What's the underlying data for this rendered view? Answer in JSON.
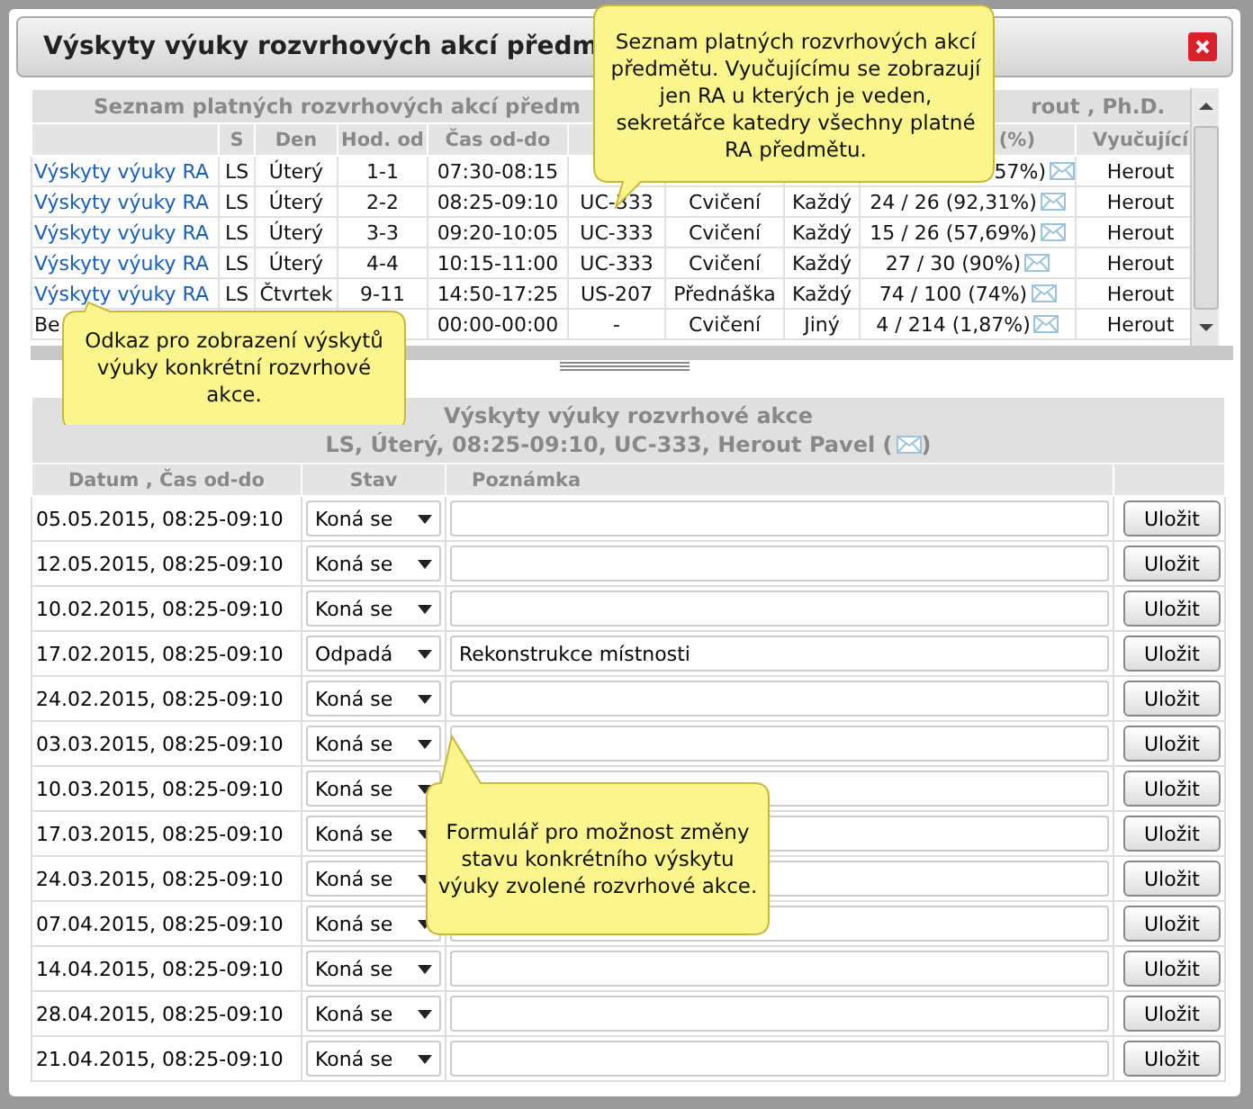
{
  "dialog": {
    "title": "Výskyty výuky rozvrhových akcí předm"
  },
  "schedule_list": {
    "title_left": "Seznam platných rozvrhových akcí předm",
    "title_right": "rout , Ph.D.",
    "columns": [
      null,
      "S",
      "Den",
      "Hod. od",
      "Čas od-do",
      null,
      null,
      null,
      "(%)",
      "Vyučující"
    ],
    "rows": [
      {
        "kind": "link",
        "cells": [
          "Výskyty výuky RA",
          "LS",
          "Úterý",
          "1-1",
          "07:30-08:15",
          null,
          null,
          null,
          "57%)",
          "Herout"
        ]
      },
      {
        "kind": "link",
        "cells": [
          "Výskyty výuky RA",
          "LS",
          "Úterý",
          "2-2",
          "08:25-09:10",
          "UC-333",
          "Cvičení",
          "Každý",
          "24 / 26 (92,31%)",
          "Herout"
        ]
      },
      {
        "kind": "link",
        "cells": [
          "Výskyty výuky RA",
          "LS",
          "Úterý",
          "3-3",
          "09:20-10:05",
          "UC-333",
          "Cvičení",
          "Každý",
          "15 / 26 (57,69%)",
          "Herout"
        ]
      },
      {
        "kind": "link",
        "cells": [
          "Výskyty výuky RA",
          "LS",
          "Úterý",
          "4-4",
          "10:15-11:00",
          "UC-333",
          "Cvičení",
          "Každý",
          "27 / 30 (90%)",
          "Herout"
        ]
      },
      {
        "kind": "link",
        "cells": [
          "Výskyty výuky RA",
          "LS",
          "Čtvrtek",
          "9-11",
          "14:50-17:25",
          "US-207",
          "Přednáška",
          "Každý",
          "74 / 100 (74%)",
          "Herout"
        ]
      },
      {
        "kind": "text",
        "cells": [
          "Be",
          null,
          null,
          null,
          "00:00-00:00",
          "-",
          "Cvičení",
          "Jiný",
          "4 / 214 (1,87%)",
          "Herout"
        ]
      }
    ]
  },
  "occurrences": {
    "title": "Výskyty výuky rozvrhové akce",
    "subtitle_before": "LS, Úterý, 08:25-09:10, UC-333, Herout Pavel (",
    "subtitle_after": ")",
    "columns": [
      "Datum , Čas od-do",
      "Stav",
      "Poznámka"
    ],
    "rows": [
      {
        "date": "05.05.2015, 08:25-09:10",
        "status": "Koná se",
        "note": null,
        "button": "Uložit"
      },
      {
        "date": "12.05.2015, 08:25-09:10",
        "status": "Koná se",
        "note": null,
        "button": "Uložit"
      },
      {
        "date": "10.02.2015, 08:25-09:10",
        "status": "Koná se",
        "note": null,
        "button": "Uložit"
      },
      {
        "date": "17.02.2015, 08:25-09:10",
        "status": "Odpadá",
        "note": "Rekonstrukce místnosti",
        "button": "Uložit"
      },
      {
        "date": "24.02.2015, 08:25-09:10",
        "status": "Koná se",
        "note": null,
        "button": "Uložit"
      },
      {
        "date": "03.03.2015, 08:25-09:10",
        "status": "Koná se",
        "note": null,
        "button": "Uložit"
      },
      {
        "date": "10.03.2015, 08:25-09:10",
        "status": "Koná se",
        "note": null,
        "button": "Uložit"
      },
      {
        "date": "17.03.2015, 08:25-09:10",
        "status": "Koná se",
        "note": null,
        "button": "Uložit"
      },
      {
        "date": "24.03.2015, 08:25-09:10",
        "status": "Koná se",
        "note": null,
        "button": "Uložit"
      },
      {
        "date": "07.04.2015, 08:25-09:10",
        "status": "Koná se",
        "note": null,
        "button": "Uložit"
      },
      {
        "date": "14.04.2015, 08:25-09:10",
        "status": "Koná se",
        "note": null,
        "button": "Uložit"
      },
      {
        "date": "28.04.2015, 08:25-09:10",
        "status": "Koná se",
        "note": null,
        "button": "Uložit"
      },
      {
        "date": "21.04.2015, 08:25-09:10",
        "status": "Koná se",
        "note": null,
        "button": "Uložit"
      }
    ]
  },
  "callouts": [
    {
      "kind": "top",
      "text": "Seznam platných rozvrhových akcí předmětu. Vyučujícímu se zobrazují jen RA u kterých je veden, sekretářce katedry všechny platné RA předmětu."
    },
    {
      "kind": "left",
      "text": "Odkaz pro zobrazení výskytů výuky konkrétní rozvrhové akce."
    },
    {
      "kind": "bottom",
      "text": "Formulář pro možnost změny stavu konkrétního výskytu výuky zvolené rozvrhové akce."
    }
  ]
}
